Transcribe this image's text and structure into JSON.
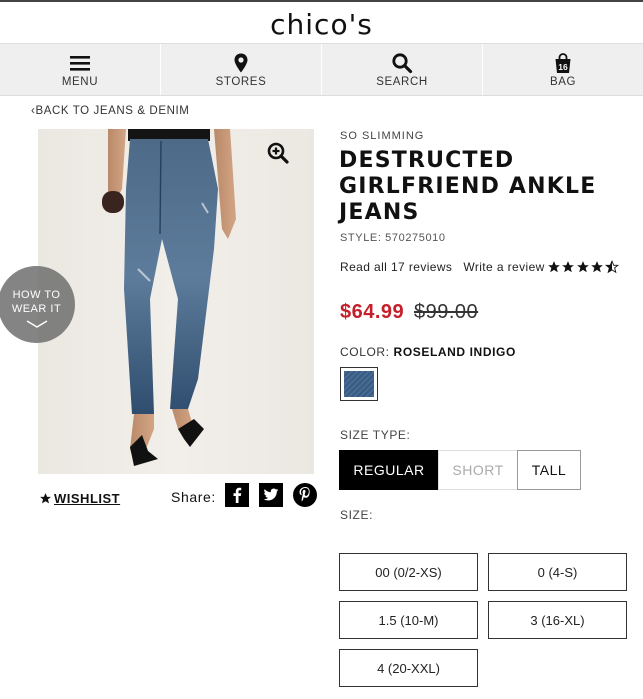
{
  "header": {
    "logo": "chico's"
  },
  "nav": {
    "items": [
      {
        "label": "MENU",
        "icon": "menu-icon"
      },
      {
        "label": "STORES",
        "icon": "location-pin-icon"
      },
      {
        "label": "SEARCH",
        "icon": "search-icon"
      },
      {
        "label": "BAG",
        "icon": "bag-icon",
        "badge": "16"
      }
    ]
  },
  "breadcrumb": {
    "chevron": "‹",
    "label": "BACK TO JEANS & DENIM"
  },
  "media": {
    "image_alt": "woman wearing distressed ankle jeans and black heels",
    "how_to_wear": {
      "line1": "HOW TO",
      "line2": "WEAR IT"
    }
  },
  "actions": {
    "wishlist": "WISHLIST",
    "share_label": "Share:",
    "social": [
      "f",
      "t",
      "p"
    ]
  },
  "product": {
    "collection": "SO SLIMMING",
    "title": "DESTRUCTED GIRLFRIEND ANKLE JEANS",
    "style": "STYLE: 570275010",
    "reviews_link": "Read all 17 reviews",
    "write_review": "Write a review",
    "rating": 4.5,
    "price_sale": "$64.99",
    "price_original": "$99.00",
    "color_label": "COLOR:",
    "color_value": "ROSELAND INDIGO",
    "size_type_label": "SIZE TYPE:",
    "size_types": [
      "REGULAR",
      "SHORT",
      "TALL"
    ],
    "size_label": "SIZE:",
    "sizes": [
      "00 (0/2-XS)",
      "0 (4-S)",
      "1.5 (10-M)",
      "3 (16-XL)",
      "4 (20-XXL)"
    ]
  },
  "colors": {
    "sale": "#c41f2a",
    "active_button": "#000000",
    "nav_bg": "#efefef"
  }
}
